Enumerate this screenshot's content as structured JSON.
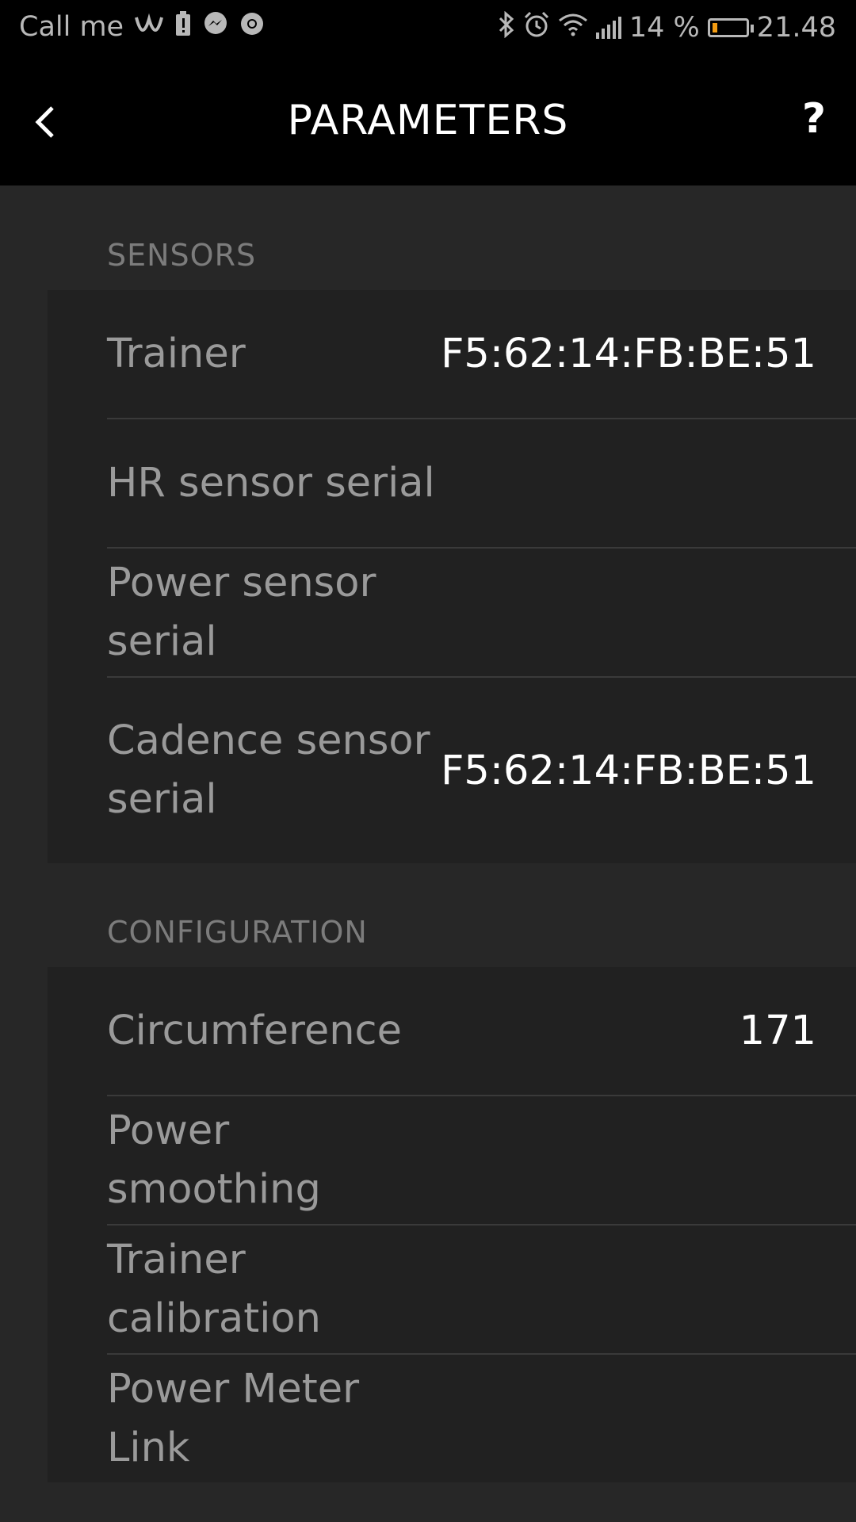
{
  "status_bar": {
    "carrier": "Call me",
    "battery_percent": "14 %",
    "time": "21.48",
    "battery_level": 0.14,
    "battery_color": "#f39c12"
  },
  "app_bar": {
    "title": "PARAMETERS",
    "help_label": "?"
  },
  "sections": {
    "sensors": {
      "header": "SENSORS",
      "rows": [
        {
          "label": "Trainer",
          "value": "F5:62:14:FB:BE:51"
        },
        {
          "label": "HR sensor serial",
          "value": ""
        },
        {
          "label": "Power sensor serial",
          "value": ""
        },
        {
          "label": "Cadence sensor serial",
          "value": "F5:62:14:FB:BE:51"
        }
      ]
    },
    "configuration": {
      "header": "CONFIGURATION",
      "rows": [
        {
          "label": "Circumference",
          "value": "171"
        },
        {
          "label": "Power smoothing",
          "value": ""
        },
        {
          "label": "Trainer calibration",
          "value": ""
        },
        {
          "label": "Power Meter Link",
          "value": ""
        }
      ]
    }
  }
}
